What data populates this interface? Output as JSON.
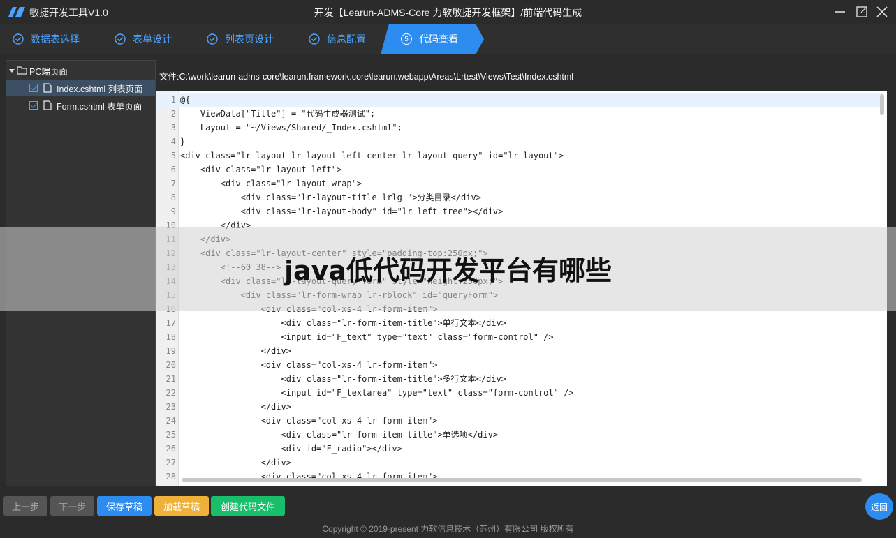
{
  "app": {
    "name": "敏捷开发工具V1.0",
    "window_title": "开发【Learun-ADMS-Core 力软敏捷开发框架】/前端代码生成"
  },
  "steps": [
    {
      "label": "数据表选择",
      "state": "done"
    },
    {
      "label": "表单设计",
      "state": "done"
    },
    {
      "label": "列表页设计",
      "state": "done"
    },
    {
      "label": "信息配置",
      "state": "done"
    },
    {
      "label": "代码查看",
      "state": "active",
      "number": "⑤"
    }
  ],
  "tree": {
    "root": "PC端页面",
    "items": [
      {
        "label": "Index.cshtml 列表页面",
        "checked": true,
        "selected": true
      },
      {
        "label": "Form.cshtml 表单页面",
        "checked": true,
        "selected": false
      }
    ]
  },
  "file_path": "文件:C:\\work\\learun-adms-core\\learun.framework.core\\learun.webapp\\Areas\\Lrtest\\Views\\Test\\Index.cshtml",
  "code_lines": [
    "@{",
    "    ViewData[\"Title\"] = \"代码生成器测试\";",
    "    Layout = \"~/Views/Shared/_Index.cshtml\";",
    "}",
    "<div class=\"lr-layout lr-layout-left-center lr-layout-query\" id=\"lr_layout\">",
    "    <div class=\"lr-layout-left\">",
    "        <div class=\"lr-layout-wrap\">",
    "            <div class=\"lr-layout-title lrlg \">分类目录</div>",
    "            <div class=\"lr-layout-body\" id=\"lr_left_tree\"></div>",
    "        </div>",
    "    </div>",
    "    <div class=\"lr-layout-center\" style=\"padding-top:250px;\">",
    "        <!--60 38-->",
    "        <div class=\"lr-layout-query-form\" style=\"height:250px;\">",
    "            <div class=\"lr-form-wrap lr-rblock\" id=\"queryForm\">",
    "                <div class=\"col-xs-4 lr-form-item\">",
    "                    <div class=\"lr-form-item-title\">单行文本</div>",
    "                    <input id=\"F_text\" type=\"text\" class=\"form-control\" />",
    "                </div>",
    "                <div class=\"col-xs-4 lr-form-item\">",
    "                    <div class=\"lr-form-item-title\">多行文本</div>",
    "                    <input id=\"F_textarea\" type=\"text\" class=\"form-control\" />",
    "                </div>",
    "                <div class=\"col-xs-4 lr-form-item\">",
    "                    <div class=\"lr-form-item-title\">单选项</div>",
    "                    <div id=\"F_radio\"></div>",
    "                </div>",
    "                <div class=\"col-xs-4 lr-form-item\">"
  ],
  "overlay_text": "java低代码开发平台有哪些",
  "footer": {
    "prev": "上一步",
    "next": "下一步",
    "save": "保存草稿",
    "load": "加载草稿",
    "create": "创建代码文件",
    "back": "返回",
    "copyright": "Copyright © 2019-present 力软信息技术（苏州）有限公司 版权所有"
  },
  "colors": {
    "accent": "#2d8cf0",
    "step_active": "#2d8cf0",
    "warning": "#f0b13b",
    "success": "#19be6b"
  }
}
